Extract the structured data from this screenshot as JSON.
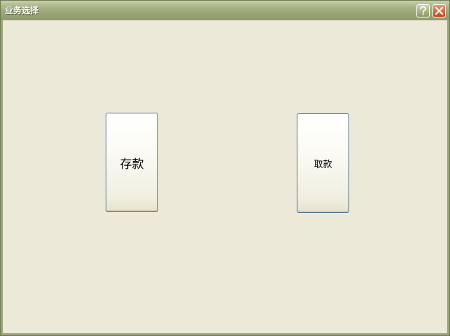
{
  "window": {
    "title": "业务选择"
  },
  "titlebar": {
    "help_icon": "help-icon",
    "close_icon": "close-icon",
    "help_glyph": "?",
    "close_color": "#c1461f"
  },
  "buttons": {
    "deposit_label": "存款",
    "withdraw_label": "取款"
  },
  "colors": {
    "titlebar": "#98a574",
    "client_bg": "#ece9d8",
    "button_border": "#4a6e8a"
  }
}
